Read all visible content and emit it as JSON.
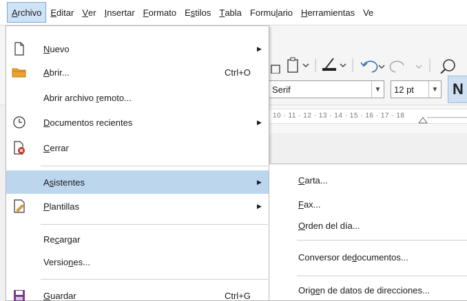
{
  "menubar": {
    "items": [
      {
        "pre": "",
        "acc": "A",
        "post": "rchivo"
      },
      {
        "pre": "",
        "acc": "E",
        "post": "ditar"
      },
      {
        "pre": "",
        "acc": "V",
        "post": "er"
      },
      {
        "pre": "",
        "acc": "I",
        "post": "nsertar"
      },
      {
        "pre": "",
        "acc": "F",
        "post": "ormato"
      },
      {
        "pre": "E",
        "acc": "s",
        "post": "tilos"
      },
      {
        "pre": "",
        "acc": "T",
        "post": "abla"
      },
      {
        "pre": "Formu",
        "acc": "l",
        "post": "ario"
      },
      {
        "pre": "",
        "acc": "H",
        "post": "erramientas"
      },
      {
        "pre": "Ve",
        "acc": "",
        "post": ""
      }
    ]
  },
  "toolbar": {
    "font_name": "Serif",
    "font_size": "12 pt",
    "bold_partial": "N"
  },
  "ruler": {
    "ticks": "10 · 11 · 12 · 13 · 14 · 15 · 16 · 17 · 18"
  },
  "file_menu": {
    "items": [
      {
        "pre": "",
        "acc": "N",
        "post": "uevo",
        "shortcut": "",
        "submenu": true
      },
      {
        "pre": "",
        "acc": "A",
        "post": "brir...",
        "shortcut": "Ctrl+O",
        "submenu": false
      },
      {
        "pre": "Abrir archivo ",
        "acc": "r",
        "post": "emoto...",
        "shortcut": "",
        "submenu": false
      },
      {
        "pre": "",
        "acc": "D",
        "post": "ocumentos recientes",
        "shortcut": "",
        "submenu": true
      },
      {
        "pre": "",
        "acc": "C",
        "post": "errar",
        "shortcut": "",
        "submenu": false
      },
      {
        "pre": "A",
        "acc": "s",
        "post": "istentes",
        "shortcut": "",
        "submenu": true
      },
      {
        "pre": "",
        "acc": "P",
        "post": "lantillas",
        "shortcut": "",
        "submenu": true
      },
      {
        "pre": "Re",
        "acc": "c",
        "post": "argar",
        "shortcut": "",
        "submenu": false
      },
      {
        "pre": "Versio",
        "acc": "n",
        "post": "es...",
        "shortcut": "",
        "submenu": false
      },
      {
        "pre": "",
        "acc": "G",
        "post": "uardar",
        "shortcut": "Ctrl+G",
        "submenu": false
      }
    ]
  },
  "submenu": {
    "items": [
      {
        "pre": "",
        "acc": "C",
        "post": "arta..."
      },
      {
        "pre": "",
        "acc": "F",
        "post": "ax..."
      },
      {
        "pre": "",
        "acc": "O",
        "post": "rden del día..."
      },
      {
        "pre": "Conversor de ",
        "acc": "d",
        "post": "ocumentos..."
      },
      {
        "pre": "Orig",
        "acc": "e",
        "post": "n de datos de direcciones..."
      }
    ]
  },
  "colors": {
    "highlight": "#bcd6ee",
    "active_menu": "#cfe3f6",
    "accent_red": "#c0392b",
    "folder_orange": "#f0a030",
    "save_purple": "#7a3a8a"
  },
  "icons": {
    "new": "page-icon",
    "open": "folder-icon",
    "recent": "clock-icon",
    "close": "close-document-icon",
    "templates": "template-icon",
    "save": "floppy-disk-icon"
  }
}
